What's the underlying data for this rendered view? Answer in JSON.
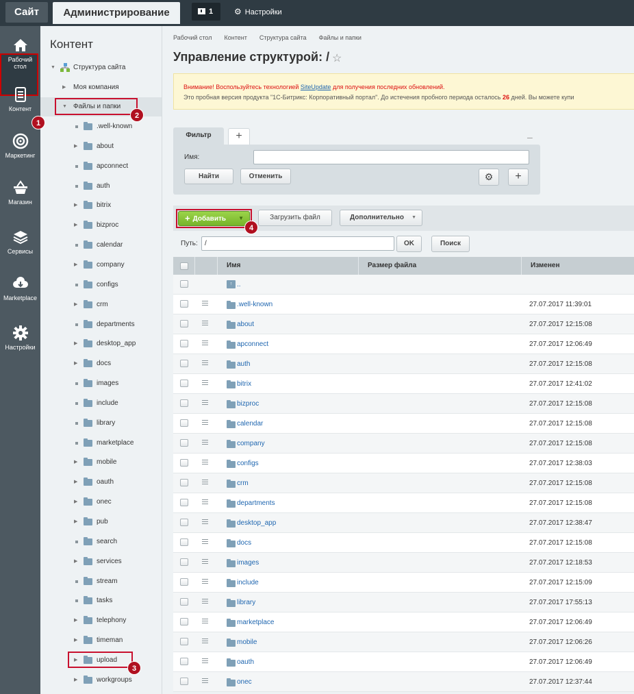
{
  "topbar": {
    "site_tab": "Сайт",
    "admin_tab": "Администрирование",
    "notifications_count": "1",
    "settings_label": "Настройки"
  },
  "rail": {
    "items": [
      {
        "label_line1": "Рабочий",
        "label_line2": "стол",
        "icon": "house-icon"
      },
      {
        "label_line1": "Контент",
        "label_line2": "",
        "icon": "document-icon"
      },
      {
        "label_line1": "Маркетинг",
        "label_line2": "",
        "icon": "target-icon"
      },
      {
        "label_line1": "Магазин",
        "label_line2": "",
        "icon": "basket-icon"
      },
      {
        "label_line1": "Сервисы",
        "label_line2": "",
        "icon": "layers-icon"
      },
      {
        "label_line1": "Marketplace",
        "label_line2": "",
        "icon": "cloud-download-icon"
      },
      {
        "label_line1": "Настройки",
        "label_line2": "",
        "icon": "gear-icon"
      }
    ]
  },
  "nav": {
    "title": "Контент",
    "site_structure": "Структура сайта",
    "my_company": "Моя компания",
    "files_folders": "Файлы и папки",
    "folders": [
      ".well-known",
      "about",
      "apconnect",
      "auth",
      "bitrix",
      "bizproc",
      "calendar",
      "company",
      "configs",
      "crm",
      "departments",
      "desktop_app",
      "docs",
      "images",
      "include",
      "library",
      "marketplace",
      "mobile",
      "oauth",
      "onec",
      "pub",
      "search",
      "services",
      "stream",
      "tasks",
      "telephony",
      "timeman",
      "upload",
      "workgroups"
    ]
  },
  "annotations": [
    "1",
    "2",
    "3",
    "4"
  ],
  "breadcrumbs": [
    "Рабочий стол",
    "Контент",
    "Структура сайта",
    "Файлы и папки"
  ],
  "page_title": "Управление структурой: /",
  "warning": {
    "line1_prefix": "Внимание! Воспользуйтесь технологией ",
    "line1_link": "SiteUpdate",
    "line1_suffix": " для получения последних обновлений.",
    "line2_prefix": "Это пробная версия продукта \"1С-Битрикс: Корпоративный портал\". До истечения пробного периода осталось ",
    "line2_days": "26",
    "line2_suffix": " дней. Вы можете купи"
  },
  "filter": {
    "tab_label": "Фильтр",
    "name_label": "Имя:",
    "find_button": "Найти",
    "cancel_button": "Отменить"
  },
  "toolbar": {
    "add_button": "Добавить",
    "upload_button": "Загрузить файл",
    "more_button": "Дополнительно",
    "path_label": "Путь:",
    "path_value": "/",
    "ok_button": "OK",
    "search_button": "Поиск"
  },
  "table": {
    "headers": {
      "name": "Имя",
      "size": "Размер файла",
      "modified": "Изменен"
    },
    "up_label": "..",
    "rows": [
      {
        "name": ".well-known",
        "date": "27.07.2017 11:39:01"
      },
      {
        "name": "about",
        "date": "27.07.2017 12:15:08"
      },
      {
        "name": "apconnect",
        "date": "27.07.2017 12:06:49"
      },
      {
        "name": "auth",
        "date": "27.07.2017 12:15:08"
      },
      {
        "name": "bitrix",
        "date": "27.07.2017 12:41:02"
      },
      {
        "name": "bizproc",
        "date": "27.07.2017 12:15:08"
      },
      {
        "name": "calendar",
        "date": "27.07.2017 12:15:08"
      },
      {
        "name": "company",
        "date": "27.07.2017 12:15:08"
      },
      {
        "name": "configs",
        "date": "27.07.2017 12:38:03"
      },
      {
        "name": "crm",
        "date": "27.07.2017 12:15:08"
      },
      {
        "name": "departments",
        "date": "27.07.2017 12:15:08"
      },
      {
        "name": "desktop_app",
        "date": "27.07.2017 12:38:47"
      },
      {
        "name": "docs",
        "date": "27.07.2017 12:15:08"
      },
      {
        "name": "images",
        "date": "27.07.2017 12:18:53"
      },
      {
        "name": "include",
        "date": "27.07.2017 12:15:09"
      },
      {
        "name": "library",
        "date": "27.07.2017 17:55:13"
      },
      {
        "name": "marketplace",
        "date": "27.07.2017 12:06:49"
      },
      {
        "name": "mobile",
        "date": "27.07.2017 12:06:26"
      },
      {
        "name": "oauth",
        "date": "27.07.2017 12:06:49"
      },
      {
        "name": "onec",
        "date": "27.07.2017 12:37:44"
      }
    ]
  }
}
